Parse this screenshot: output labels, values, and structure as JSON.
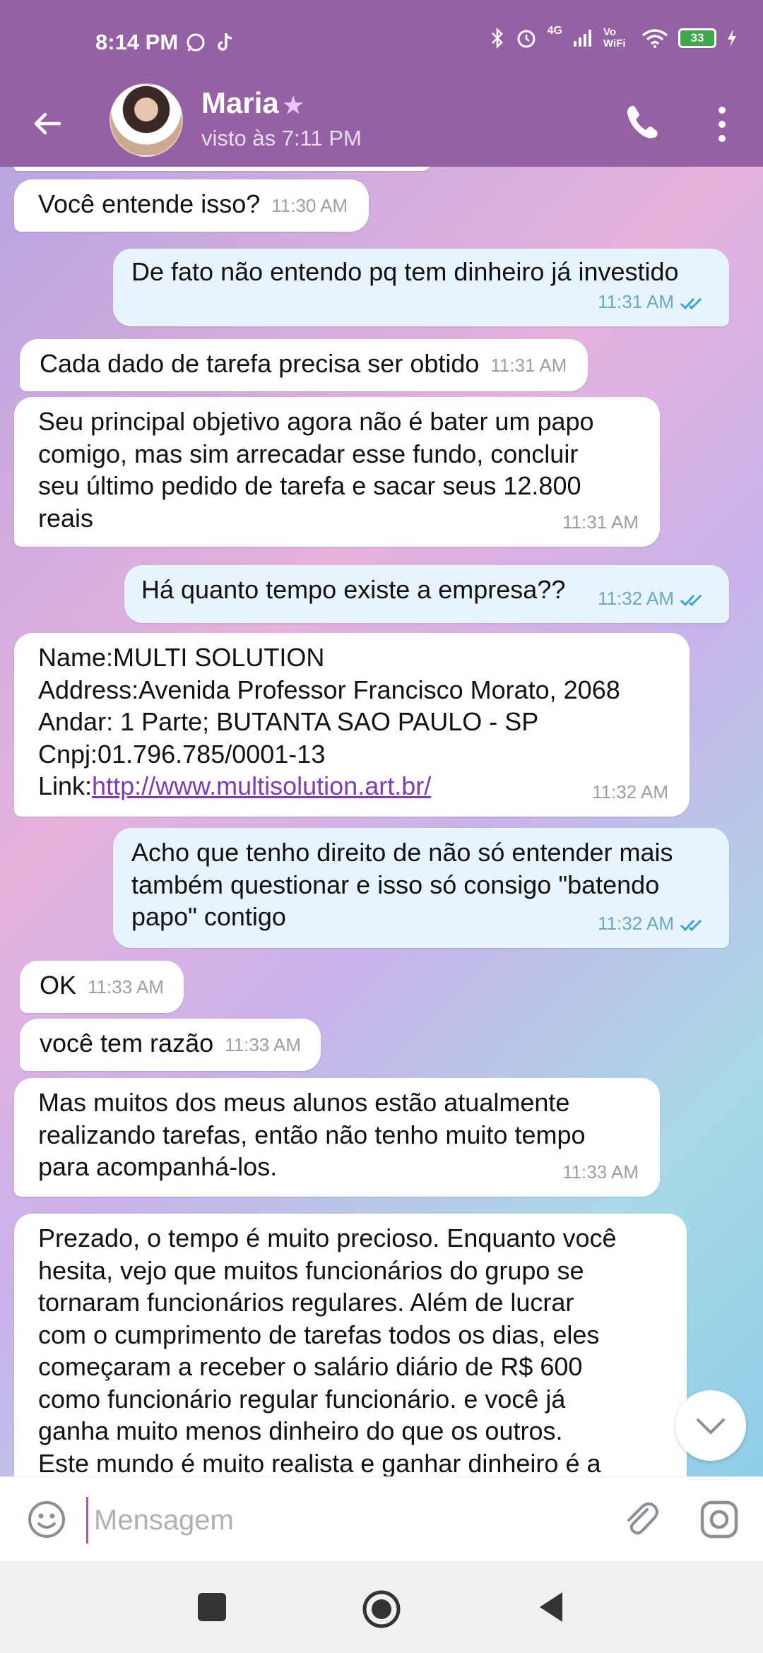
{
  "status_bar": {
    "time": "8:14 PM",
    "network_label": "4G",
    "volte_label": "Vo WiFi",
    "battery": "33",
    "app_icons": [
      "whatsapp-icon",
      "tiktok-icon"
    ],
    "right_icons": [
      "bluetooth-icon",
      "alarm-icon",
      "signal-icon",
      "wifi-icon",
      "battery-icon",
      "charging-icon"
    ]
  },
  "header": {
    "contact_name": "Maria",
    "last_seen": "visto às 7:11 PM",
    "accent_color": "#9561a3"
  },
  "messages": [
    {
      "direction": "in",
      "text": "Você entende isso?",
      "time": "11:30 AM"
    },
    {
      "direction": "out",
      "text": "De fato não entendo pq tem dinheiro já investido",
      "time": "11:31 AM",
      "read": true
    },
    {
      "direction": "in",
      "text": "Cada dado de tarefa precisa ser obtido",
      "time": "11:31 AM"
    },
    {
      "direction": "in",
      "text": "Seu principal objetivo agora não é bater um papo\ncomigo, mas sim arrecadar esse fundo, concluir\nseu último pedido de tarefa e sacar seus 12.800\nreais",
      "time": "11:31 AM"
    },
    {
      "direction": "out",
      "text": "Há quanto tempo existe a empresa??",
      "time": "11:32 AM",
      "read": true
    },
    {
      "direction": "in",
      "text": "Name:MULTI SOLUTION\nAddress:Avenida Professor Francisco Morato, 2068\nAndar: 1 Parte; BUTANTA SAO PAULO - SP\nCnpj:01.796.785/0001-13",
      "link_prefix": "Link:",
      "link_text": "http://www.multisolution.art.br/",
      "time": "11:32 AM"
    },
    {
      "direction": "out",
      "text": "Acho que tenho direito de não só entender mais\ntambém questionar e isso só consigo \"batendo\npapo\" contigo",
      "time": "11:32 AM",
      "read": true
    },
    {
      "direction": "in",
      "text": "OK",
      "time": "11:33 AM"
    },
    {
      "direction": "in",
      "text": "você tem razão",
      "time": "11:33 AM"
    },
    {
      "direction": "in",
      "text": "Mas muitos dos meus alunos estão atualmente\nrealizando tarefas, então não tenho muito tempo\npara acompanhá-los.",
      "time": "11:33 AM"
    },
    {
      "direction": "in",
      "text": "Prezado, o tempo é muito precioso. Enquanto você\nhesita, vejo que muitos funcionários do grupo se\ntornaram funcionários regulares. Além de lucrar\ncom o cumprimento de tarefas todos os dias, eles\ncomeçaram a receber o salário diário de R$ 600\ncomo funcionário regular funcionário. e você já\nganha muito menos dinheiro do que os outros.\nEste mundo é muito realista e ganhar dinheiro é a"
    }
  ],
  "composer": {
    "placeholder": "Mensagem"
  }
}
